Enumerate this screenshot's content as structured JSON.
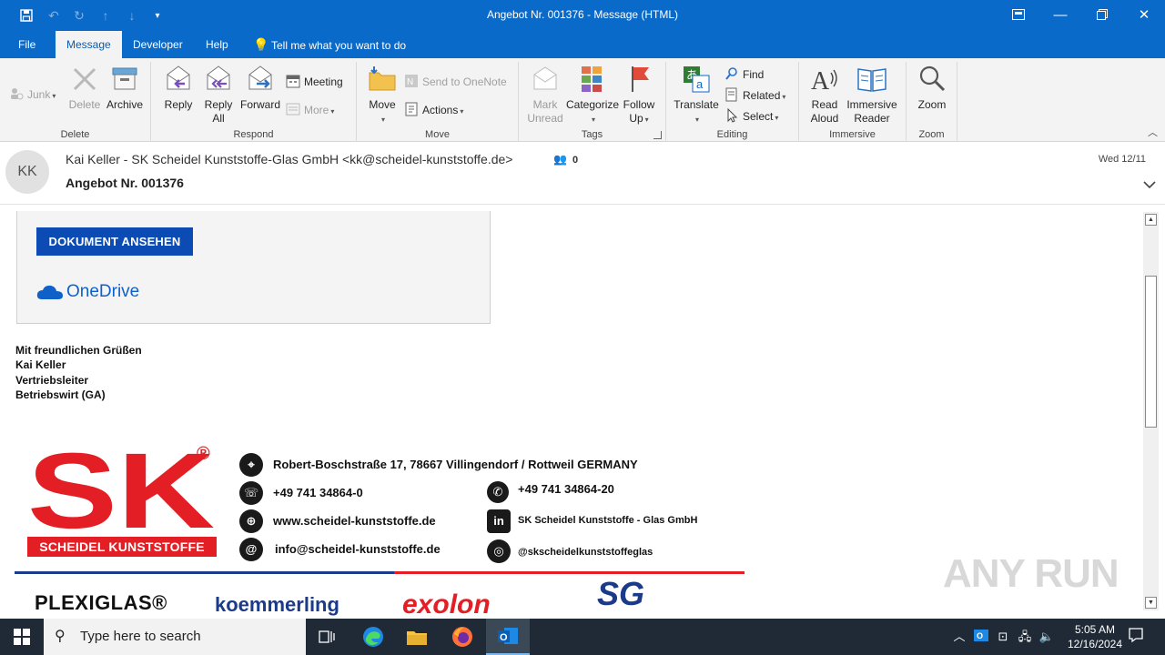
{
  "window": {
    "title": "Angebot Nr. 001376  -  Message (HTML)"
  },
  "menu": {
    "tabs": [
      "File",
      "Message",
      "Developer",
      "Help"
    ],
    "active": "Message",
    "tell_me": "Tell me what you want to do"
  },
  "ribbon": {
    "delete_group": {
      "label": "Delete",
      "junk": "Junk",
      "delete": "Delete",
      "archive": "Archive"
    },
    "respond_group": {
      "label": "Respond",
      "reply": "Reply",
      "reply_all_1": "Reply",
      "reply_all_2": "All",
      "forward": "Forward",
      "meeting": "Meeting",
      "more": "More"
    },
    "move_group": {
      "label": "Move",
      "move": "Move",
      "onenote": "Send to OneNote",
      "actions": "Actions"
    },
    "tags_group": {
      "label": "Tags",
      "mark_unread_1": "Mark",
      "mark_unread_2": "Unread",
      "categorize": "Categorize",
      "follow_up_1": "Follow",
      "follow_up_2": "Up"
    },
    "editing_group": {
      "label": "Editing",
      "translate": "Translate",
      "find": "Find",
      "related": "Related",
      "select": "Select"
    },
    "immersive_group": {
      "label": "Immersive",
      "read_aloud_1": "Read",
      "read_aloud_2": "Aloud",
      "immersive_reader_1": "Immersive",
      "immersive_reader_2": "Reader"
    },
    "zoom_group": {
      "label": "Zoom",
      "zoom": "Zoom"
    }
  },
  "message": {
    "avatar_initials": "KK",
    "sender": "Kai Keller - SK Scheidel Kunststoffe-Glas GmbH <kk@scheidel-kunststoffe.de>",
    "people_count": "0",
    "date": "Wed 12/11",
    "subject": "Angebot Nr. 001376"
  },
  "body": {
    "button": "DOKUMENT ANSEHEN",
    "onedrive": "OneDrive",
    "signature": [
      "Mit freundlichen  Grüßen",
      "Kai Keller",
      "Vertriebsleiter",
      "Betriebswirt  (GA)"
    ],
    "banner": {
      "logo_main": "SK",
      "logo_sub": "SCHEIDEL KUNSTSTOFFE",
      "registered": "®",
      "address": "Robert-Boschstraße 17, 78667 Villingendorf / Rottweil GERMANY",
      "phone": "+49 741 34864-0",
      "fax": "+49 741 34864-20",
      "web": "www.scheidel-kunststoffe.de",
      "linkedin": "SK Scheidel Kunststoffe - Glas GmbH",
      "email": "info@scheidel-kunststoffe.de",
      "instagram": "@skscheidelkunststoffeglas",
      "brands": [
        "PLEXIGLAS®",
        "koemmerling",
        "exolon",
        "SG"
      ]
    }
  },
  "watermark": "ANY RUN",
  "taskbar": {
    "search_placeholder": "Type here to search",
    "time": "5:05 AM",
    "date": "12/16/2024"
  }
}
